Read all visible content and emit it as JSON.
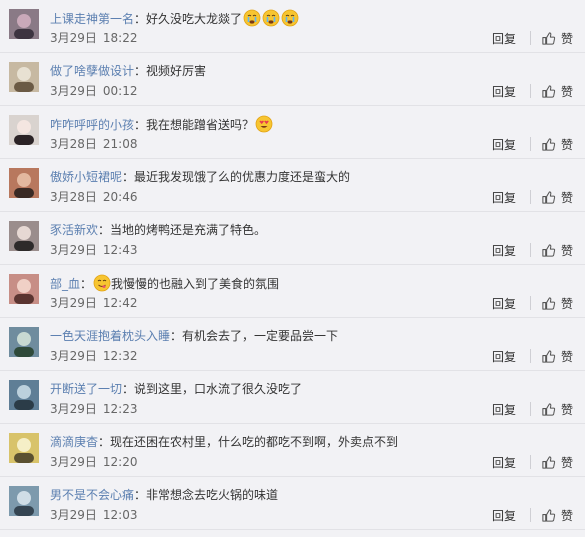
{
  "labels": {
    "reply": "回复",
    "like": "赞"
  },
  "separator": "：",
  "comments": [
    {
      "user": "上课走神第一名",
      "text": "好久没吃大龙燚了",
      "emojis": [
        "cry",
        "cry",
        "cry"
      ],
      "emoji_position": "after",
      "date": "3月29日",
      "time": "18:22",
      "avatar_colors": [
        "#8a7a86",
        "#c9a9b9",
        "#3d3440"
      ]
    },
    {
      "user": "做了啥孽做设计",
      "text": "视频好厉害",
      "emojis": [],
      "emoji_position": "after",
      "date": "3月29日",
      "time": "00:12",
      "avatar_colors": [
        "#c7b9a2",
        "#e8e1d2",
        "#6b5a44"
      ]
    },
    {
      "user": "咋咋呼呼的小孩",
      "text": "我在想能蹭省送吗？",
      "emojis": [
        "heart-eyes"
      ],
      "emoji_position": "after",
      "date": "3月28日",
      "time": "21:08",
      "avatar_colors": [
        "#d9d3cf",
        "#f4e6e1",
        "#2b2326"
      ]
    },
    {
      "user": "傲娇小短裙呢",
      "text": "最近我发现饿了么的优惠力度还是蛮大的",
      "emojis": [],
      "emoji_position": "after",
      "date": "3月28日",
      "time": "20:46",
      "avatar_colors": [
        "#b8785e",
        "#e3b89f",
        "#3a2a24"
      ]
    },
    {
      "user": "豕活新欢",
      "text": "当地的烤鸭还是充满了特色。",
      "emojis": [],
      "emoji_position": "after",
      "date": "3月29日",
      "time": "12:43",
      "avatar_colors": [
        "#9a8d8c",
        "#e6d8d3",
        "#2d2a2a"
      ]
    },
    {
      "user": "部_血",
      "text": "我慢慢的也融入到了美食的氛围",
      "emojis": [
        "yum"
      ],
      "emoji_position": "before",
      "date": "3月29日",
      "time": "12:42",
      "avatar_colors": [
        "#c78e86",
        "#f0d0c6",
        "#5a3430"
      ]
    },
    {
      "user": "一色天涯抱着枕头入睡",
      "text": "有机会去了，一定要品尝一下",
      "emojis": [],
      "emoji_position": "after",
      "date": "3月29日",
      "time": "12:32",
      "avatar_colors": [
        "#6f8c9e",
        "#c8d9d2",
        "#2f4a3a"
      ]
    },
    {
      "user": "开断送了一切",
      "text": "说到这里，口水流了很久没吃了",
      "emojis": [],
      "emoji_position": "after",
      "date": "3月29日",
      "time": "12:23",
      "avatar_colors": [
        "#5f7e96",
        "#bcd0dc",
        "#2b3c48"
      ]
    },
    {
      "user": "滴滴庚杳",
      "text": "现在还困在农村里，什么吃的都吃不到啊，外卖点不到",
      "emojis": [],
      "emoji_position": "after",
      "date": "3月29日",
      "time": "12:20",
      "avatar_colors": [
        "#d8c36a",
        "#f5efc7",
        "#5a5030"
      ]
    },
    {
      "user": "男不是不会心痛",
      "text": "非常想念去吃火锅的味道",
      "emojis": [],
      "emoji_position": "after",
      "date": "3月29日",
      "time": "12:03",
      "avatar_colors": [
        "#7d9aad",
        "#cfdde6",
        "#354552"
      ]
    }
  ]
}
